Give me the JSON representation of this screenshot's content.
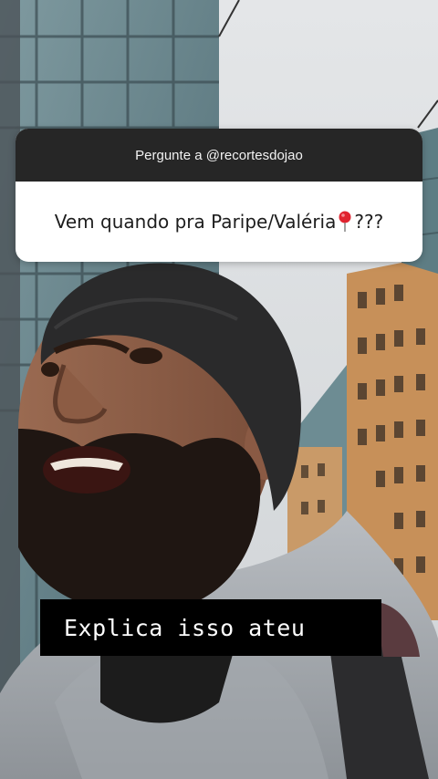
{
  "question_sticker": {
    "header": "Pergunte a @recortesdojao",
    "text_before_icon": "Vem quando pra Paripe/Valéria",
    "icon": "round-pushpin-icon",
    "text_after_icon": "???"
  },
  "caption": {
    "text": "Explica isso ateu"
  },
  "colors": {
    "sticker_header_bg": "#262626",
    "sticker_body_bg": "#ffffff",
    "caption_bg": "#000000",
    "caption_text": "#ffffff"
  }
}
